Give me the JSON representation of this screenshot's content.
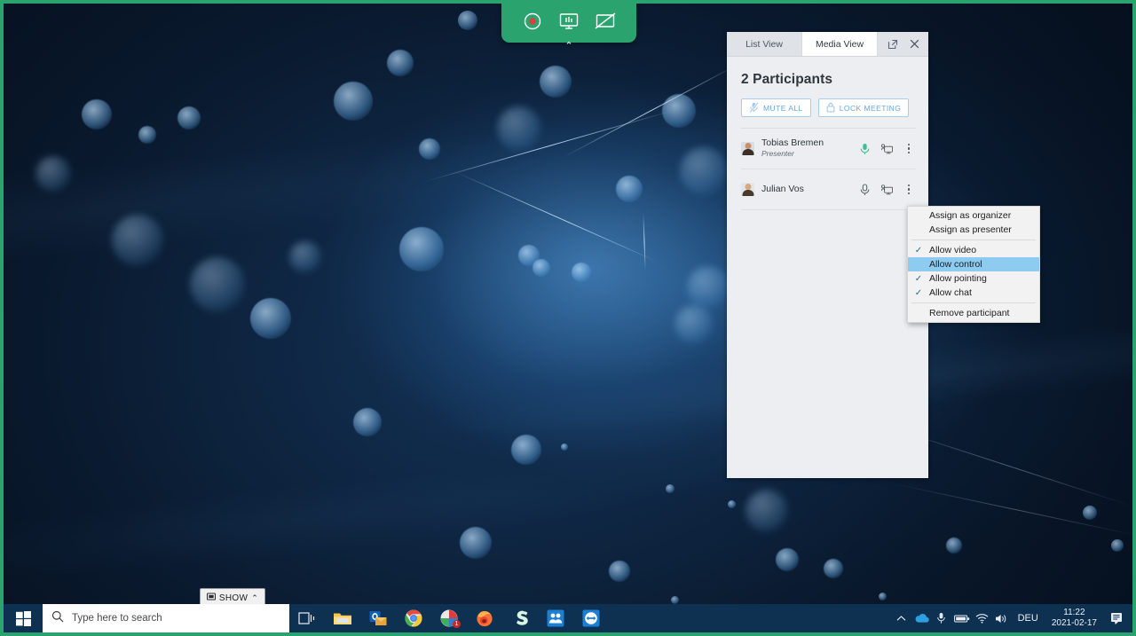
{
  "colors": {
    "share_border_green": "#2aa36f",
    "panel_bg": "#eceef1",
    "taskbar_bg": "#0e3151",
    "menu_highlight": "#8ecbf0",
    "accent_blue": "#6ba6d8",
    "mic_active_green": "#3fbf8f"
  },
  "share_toolbar": {
    "buttons": [
      {
        "name": "record-button",
        "icon": "record-icon"
      },
      {
        "name": "share-screen-button",
        "icon": "monitor-share-icon"
      },
      {
        "name": "stop-sharing-button",
        "icon": "monitor-slash-icon"
      }
    ],
    "collapse_caret": "⌃"
  },
  "panel": {
    "tabs": [
      {
        "label": "List View",
        "active": false
      },
      {
        "label": "Media View",
        "active": true
      }
    ],
    "tab_icons": [
      {
        "name": "pop-out-icon",
        "glyph": "↗"
      },
      {
        "name": "close-icon",
        "glyph": "✕"
      }
    ],
    "title": "2 Participants",
    "actions": [
      {
        "label": "MUTE ALL",
        "icon": "mic-muted-icon"
      },
      {
        "label": "LOCK MEETING",
        "icon": "lock-icon"
      }
    ],
    "participants": [
      {
        "name": "Tobias Bremen",
        "role": "Presenter",
        "mic_state": "active",
        "share_state": "idle"
      },
      {
        "name": "Julian Vos",
        "role": "",
        "mic_state": "inactive",
        "share_state": "idle"
      }
    ]
  },
  "context_menu": {
    "items": [
      {
        "label": "Assign as organizer",
        "checked": false,
        "selected": false,
        "separator_after": false
      },
      {
        "label": "Assign as presenter",
        "checked": false,
        "selected": false,
        "separator_after": true
      },
      {
        "label": "Allow video",
        "checked": true,
        "selected": false,
        "separator_after": false
      },
      {
        "label": "Allow control",
        "checked": false,
        "selected": true,
        "separator_after": false
      },
      {
        "label": "Allow pointing",
        "checked": true,
        "selected": false,
        "separator_after": false
      },
      {
        "label": "Allow chat",
        "checked": true,
        "selected": false,
        "separator_after": true
      },
      {
        "label": "Remove participant",
        "checked": false,
        "selected": false,
        "separator_after": false
      }
    ],
    "check_glyph": "✓"
  },
  "show_button": {
    "label": "SHOW",
    "caret": "⌃"
  },
  "taskbar": {
    "search_placeholder": "Type here to search",
    "apps": [
      {
        "name": "task-view-icon",
        "badge": ""
      },
      {
        "name": "file-explorer-icon",
        "badge": ""
      },
      {
        "name": "outlook-icon",
        "badge": ""
      },
      {
        "name": "chrome-icon",
        "badge": ""
      },
      {
        "name": "red-app-icon",
        "badge": "1"
      },
      {
        "name": "firefox-icon",
        "badge": ""
      },
      {
        "name": "skype-s-icon",
        "badge": ""
      },
      {
        "name": "meeting-people-icon",
        "badge": ""
      },
      {
        "name": "blue-arrows-icon",
        "badge": ""
      }
    ],
    "tray": [
      {
        "name": "show-hidden-icons-icon",
        "glyph": "⌃"
      },
      {
        "name": "onedrive-icon",
        "glyph": "☁"
      },
      {
        "name": "microphone-icon",
        "glyph": "🎤"
      },
      {
        "name": "battery-icon",
        "glyph": "▬"
      },
      {
        "name": "wifi-icon",
        "glyph": "◠"
      },
      {
        "name": "volume-icon",
        "glyph": "🔊"
      }
    ],
    "language": "DEU",
    "clock_time": "11:22",
    "clock_date": "2021-02-17",
    "notification_icon": "action-center-icon"
  }
}
